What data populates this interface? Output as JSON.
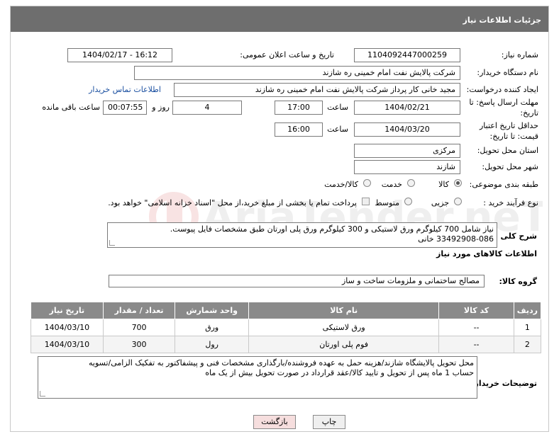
{
  "header": {
    "title": "جزئیات اطلاعات نیاز"
  },
  "form": {
    "need_number_label": "شماره نیاز:",
    "need_number": "1104092447000259",
    "announce_label": "تاریخ و ساعت اعلان عمومی:",
    "announce_value": "1404/02/17 - 16:12",
    "buyer_org_label": "نام دستگاه خریدار:",
    "buyer_org": "شرکت پالایش نفت امام خمینی  ره  شازند",
    "creator_label": "ایجاد کننده درخواست:",
    "creator": "مجید خانی کار پرداز شرکت پالایش نفت امام خمینی  ره  شازند",
    "contact_link": "اطلاعات تماس خریدار",
    "reply_deadline_label": "مهلت ارسال پاسخ: تا تاریخ:",
    "reply_date": "1404/02/21",
    "time_label": "ساعت",
    "reply_time": "17:00",
    "days_value": "4",
    "days_label": "روز و",
    "remaining_time": "00:07:55",
    "remaining_label": "ساعت باقی مانده",
    "validity_label": "حداقل تاریخ اعتبار قیمت: تا تاریخ:",
    "validity_date": "1404/03/20",
    "validity_time": "16:00",
    "province_label": "استان محل تحویل:",
    "province": "مرکزی",
    "city_label": "شهر محل تحویل:",
    "city": "شازند",
    "category_label": "طبقه بندی موضوعی:",
    "category_options": [
      "کالا",
      "خدمت",
      "کالا/خدمت"
    ],
    "category_selected": "کالا",
    "process_label": "نوع فرآیند خرید :",
    "process_options": [
      "جزیی",
      "متوسط"
    ],
    "process_selected": "جزیی",
    "payment_note": "پرداخت تمام یا بخشی از مبلغ خرید،از محل \"اسناد خزانه اسلامی\" خواهد بود.",
    "description_label": "شرح کلی نیاز:",
    "description_lines": [
      "نیاز شامل 700 کیلوگرم ورق لاستیکی و 300 کیلوگرم ورق پلی اورتان طبق مشخصات فایل پیوست.",
      "33492908-086 خانی"
    ]
  },
  "goods": {
    "section_title": "اطلاعات کالاهای مورد نیاز",
    "group_label": "گروه کالا:",
    "group_value": "مصالح ساختمانی و ملزومات ساخت و ساز",
    "columns": [
      "ردیف",
      "کد کالا",
      "نام کالا",
      "واحد شمارش",
      "تعداد / مقدار",
      "تاریخ نیاز"
    ],
    "rows": [
      {
        "row": "1",
        "code": "--",
        "name": "ورق لاستیکی",
        "unit": "ورق",
        "qty": "700",
        "date": "1404/03/10"
      },
      {
        "row": "2",
        "code": "--",
        "name": "فوم پلی اورتان",
        "unit": "رول",
        "qty": "300",
        "date": "1404/03/10"
      }
    ]
  },
  "buyer_notes": {
    "label": "توضیحات خریدار:",
    "lines": [
      "محل تحویل پالایشگاه شازند/هزینه حمل به عهده فروشنده/بارگذاری مشخصات فنی و پیشفاکتور به تفکیک الزامی/تسویه",
      "حساب 1 ماه پس از تحویل و تایید کالا/عقد قرارداد در صورت تحویل بیش از یک ماه"
    ]
  },
  "buttons": {
    "print": "چاپ",
    "back": "بازگشت"
  },
  "watermark": {
    "text": "AriaTender.neT"
  },
  "colors": {
    "header_bg": "#6e6e6e",
    "table_head_bg": "#8a8a8a",
    "link": "#1a4fa0",
    "back_btn": "#f6dede"
  }
}
